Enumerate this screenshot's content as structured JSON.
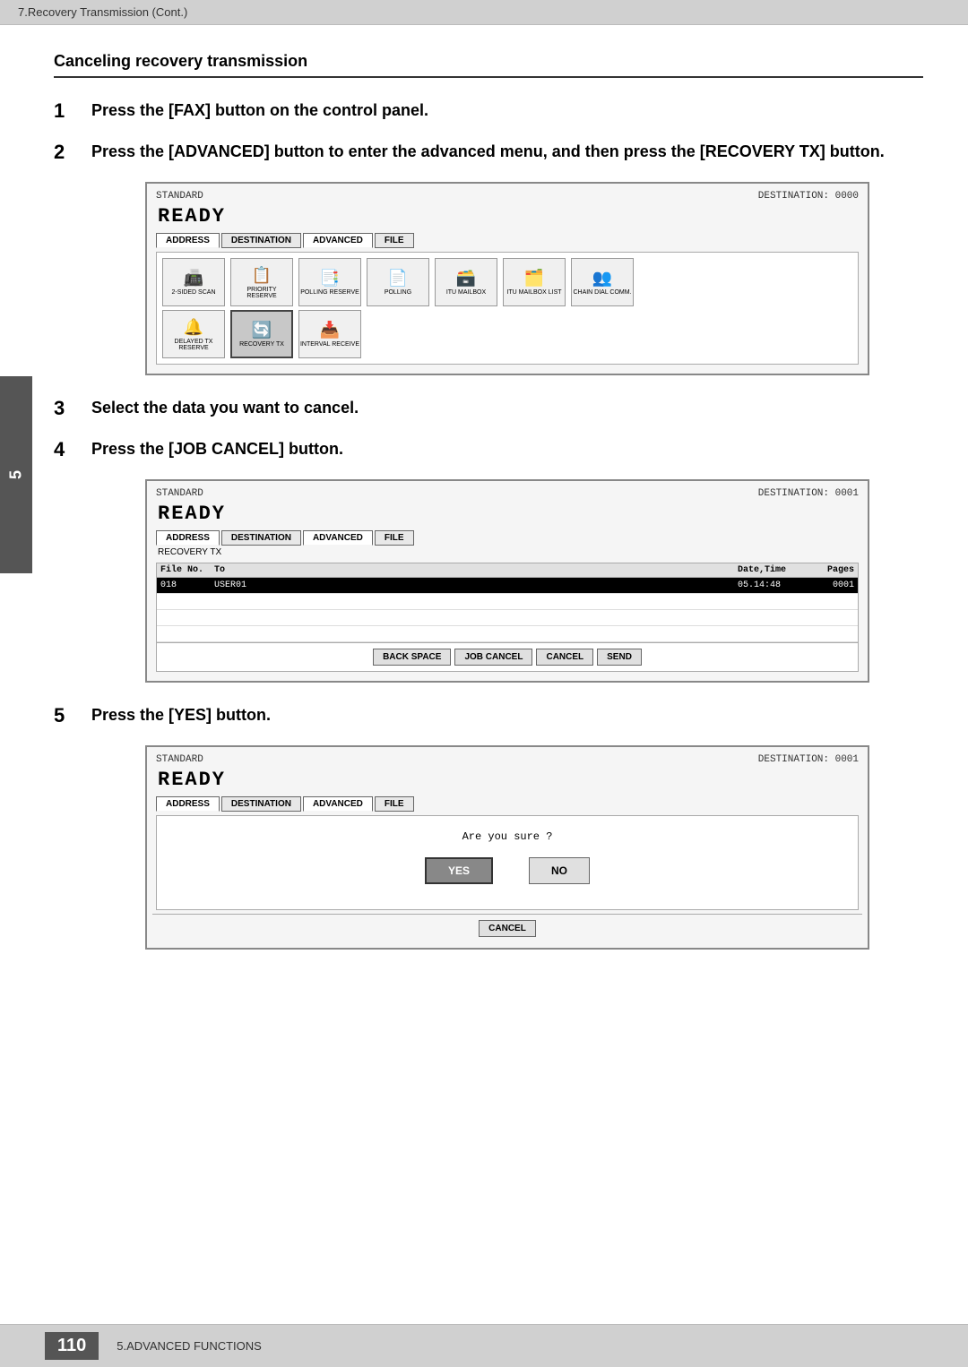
{
  "header": {
    "label": "7.Recovery Transmission (Cont.)"
  },
  "section": {
    "title": "Canceling recovery transmission"
  },
  "steps": [
    {
      "number": "1",
      "text": "Press the [FAX] button on the control panel."
    },
    {
      "number": "2",
      "text": "Press the [ADVANCED] button to enter the advanced menu, and then press the [RECOVERY TX] button."
    },
    {
      "number": "3",
      "text": "Select the data you want to cancel."
    },
    {
      "number": "4",
      "text": "Press the [JOB CANCEL] button."
    },
    {
      "number": "5",
      "text": "Press the [YES] button."
    }
  ],
  "screen1": {
    "mode": "STANDARD",
    "destination": "DESTINATION: 0000",
    "status": "READY",
    "tabs": [
      "ADDRESS",
      "DESTINATION",
      "ADVANCED",
      "FILE"
    ],
    "icons": [
      "2-SIDED SCAN",
      "PRIORITY RESERVE",
      "POLLING RESERVE",
      "POLLING",
      "ITU MAILBOX",
      "ITU MAILBOX LIST",
      "CHAIN DIAL COMM.",
      "DELAYED TX RESERVE",
      "RECOVERY TX",
      "INTERVAL RECEIVE"
    ]
  },
  "screen2": {
    "mode": "STANDARD",
    "destination": "DESTINATION: 0001",
    "status": "READY",
    "tabs": [
      "ADDRESS",
      "DESTINATION",
      "ADVANCED",
      "FILE"
    ],
    "section_label": "RECOVERY TX",
    "table": {
      "headers": [
        "File No.",
        "To",
        "Date,Time",
        "Pages"
      ],
      "rows": [
        {
          "fileno": "018",
          "to": "USER01",
          "datetime": "05.14:48",
          "pages": "0001"
        }
      ]
    },
    "buttons": [
      "BACK SPACE",
      "JOB CANCEL",
      "CANCEL",
      "SEND"
    ]
  },
  "screen3": {
    "mode": "STANDARD",
    "destination": "DESTINATION: 0001",
    "status": "READY",
    "tabs": [
      "ADDRESS",
      "DESTINATION",
      "ADVANCED",
      "FILE"
    ],
    "question": "Are you sure ?",
    "buttons_yn": [
      "YES",
      "NO"
    ],
    "cancel_button": "CANCEL"
  },
  "side_tab": "5",
  "footer": {
    "page": "110",
    "label": "5.ADVANCED FUNCTIONS"
  }
}
